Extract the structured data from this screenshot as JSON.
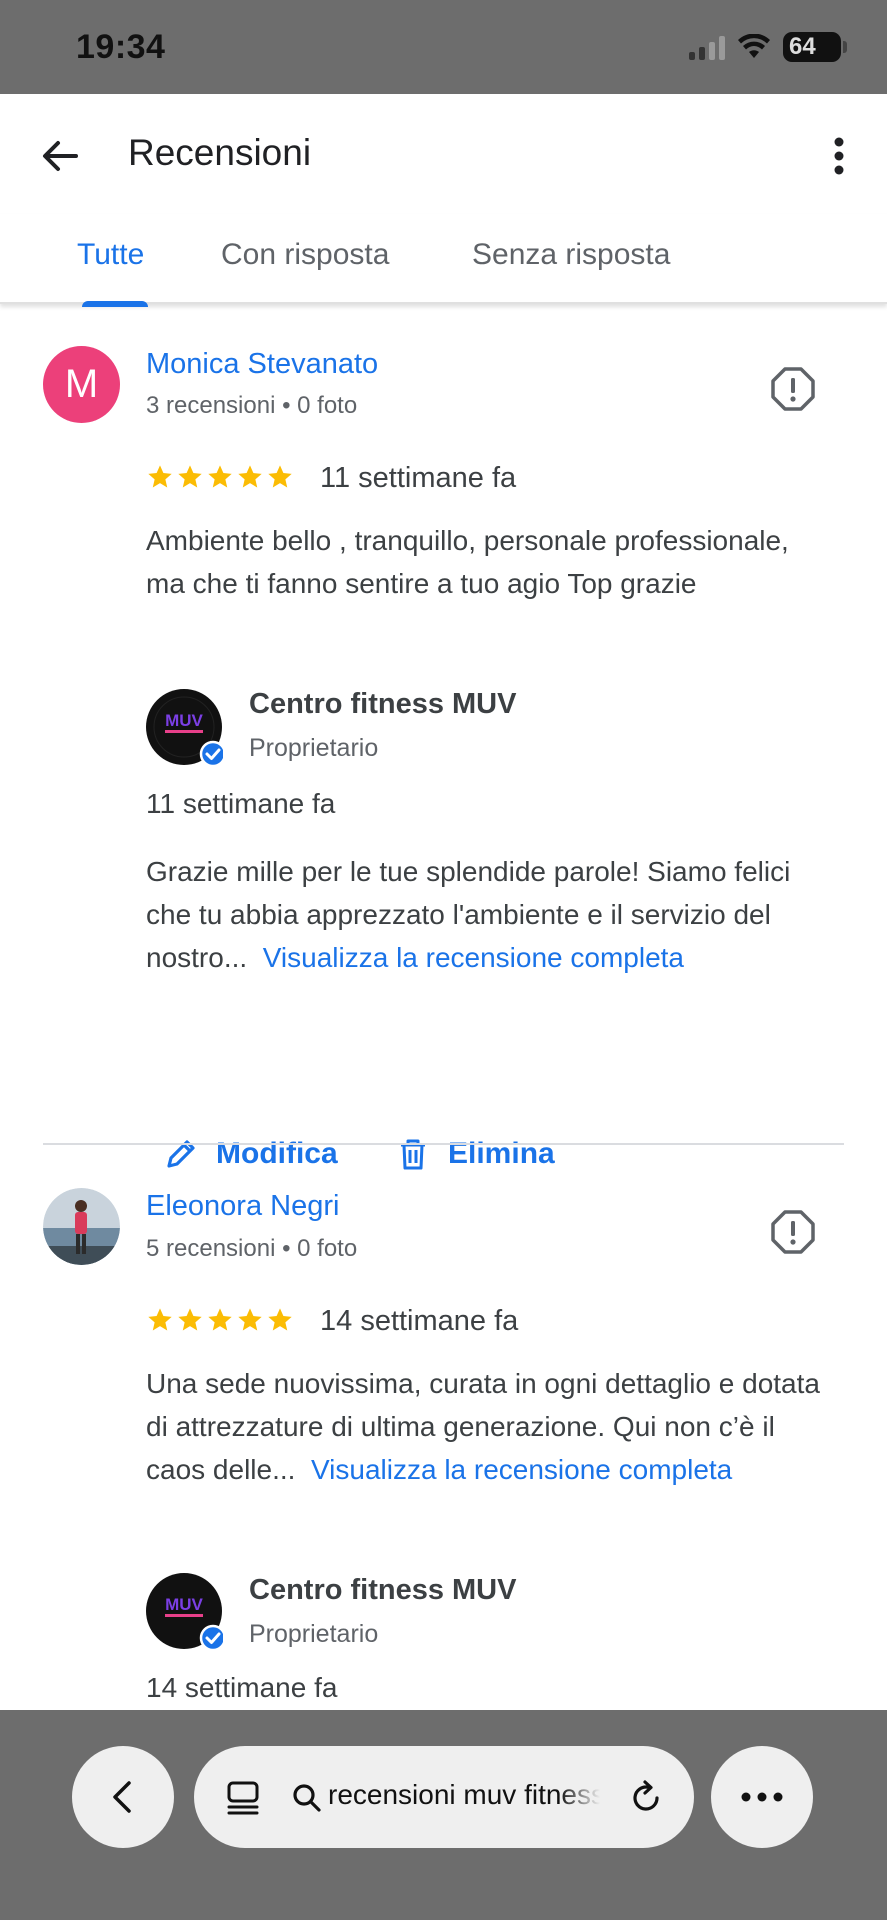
{
  "status": {
    "time": "19:34",
    "battery": "64"
  },
  "header": {
    "title": "Recensioni"
  },
  "tabs": [
    {
      "label": "Tutte",
      "active": true
    },
    {
      "label": "Con risposta",
      "active": false
    },
    {
      "label": "Senza risposta",
      "active": false
    }
  ],
  "reviews": [
    {
      "avatar_letter": "M",
      "name": "Monica Stevanato",
      "meta": "3 recensioni • 0 foto",
      "rating": 5,
      "date": "11 settimane fa",
      "text": "Ambiente bello , tranquillo, personale professionale, ma che ti fanno sentire a tuo agio Top grazie",
      "owner": {
        "name": "Centro fitness MUV",
        "role": "Proprietario",
        "date": "11 settimane fa",
        "reply": "Grazie mille per le tue splendide parole! Siamo felici che tu abbia apprezzato l'ambiente e il servizio del nostro...",
        "more_link": "Visualizza la recensione completa"
      },
      "actions": {
        "edit": "Modifica",
        "delete": "Elimina"
      }
    },
    {
      "name": "Eleonora Negri",
      "meta": "5 recensioni • 0 foto",
      "rating": 5,
      "date": "14 settimane fa",
      "text": "Una sede nuovissima, curata in ogni dettaglio e dotata di attrezzature di ultima generazione. Qui non c’è il caos delle...",
      "more_link": "Visualizza la recensione completa",
      "owner": {
        "name": "Centro fitness MUV",
        "role": "Proprietario",
        "date": "14 settimane fa"
      }
    }
  ],
  "browser": {
    "url_text": "recensioni muv fitness"
  },
  "colors": {
    "accent": "#1a73e8",
    "star": "#fbbc04",
    "avatar_m": "#ec407a",
    "chrome": "#6d6d6d"
  }
}
